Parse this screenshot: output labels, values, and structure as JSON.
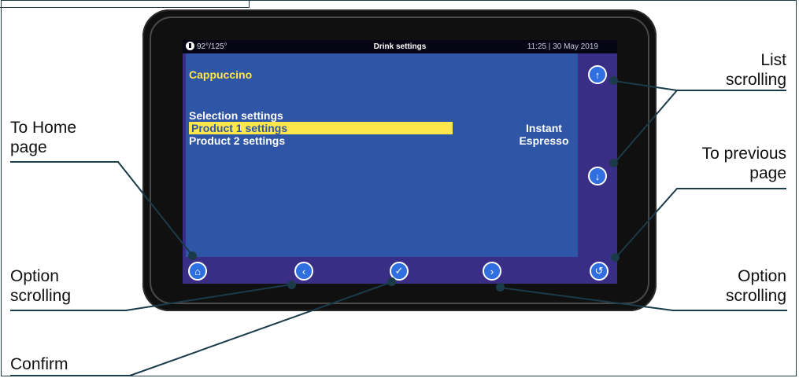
{
  "status": {
    "temp": "92°/125°",
    "title": "Drink settings",
    "time": "11:25 | 30 May 2019"
  },
  "drink": {
    "name": "Cappuccino"
  },
  "menu": [
    {
      "label": "Selection settings",
      "value": ""
    },
    {
      "label": "Product 1 settings",
      "value": "Instant"
    },
    {
      "label": "Product 2 settings",
      "value": "Espresso"
    }
  ],
  "callouts": {
    "home_1": "To Home",
    "home_2": "page",
    "list_1": "List",
    "list_2": "scrolling",
    "prev_1": "To previous",
    "prev_2": "page",
    "optl_1": "Option",
    "optl_2": "scrolling",
    "optr_1": "Option",
    "optr_2": "scrolling",
    "confirm": "Confirm"
  },
  "icons": [
    "home-icon",
    "arrow-left-icon",
    "check-icon",
    "arrow-right-icon",
    "back-icon",
    "arrow-up-icon",
    "arrow-down-icon",
    "thermometer-icon"
  ]
}
